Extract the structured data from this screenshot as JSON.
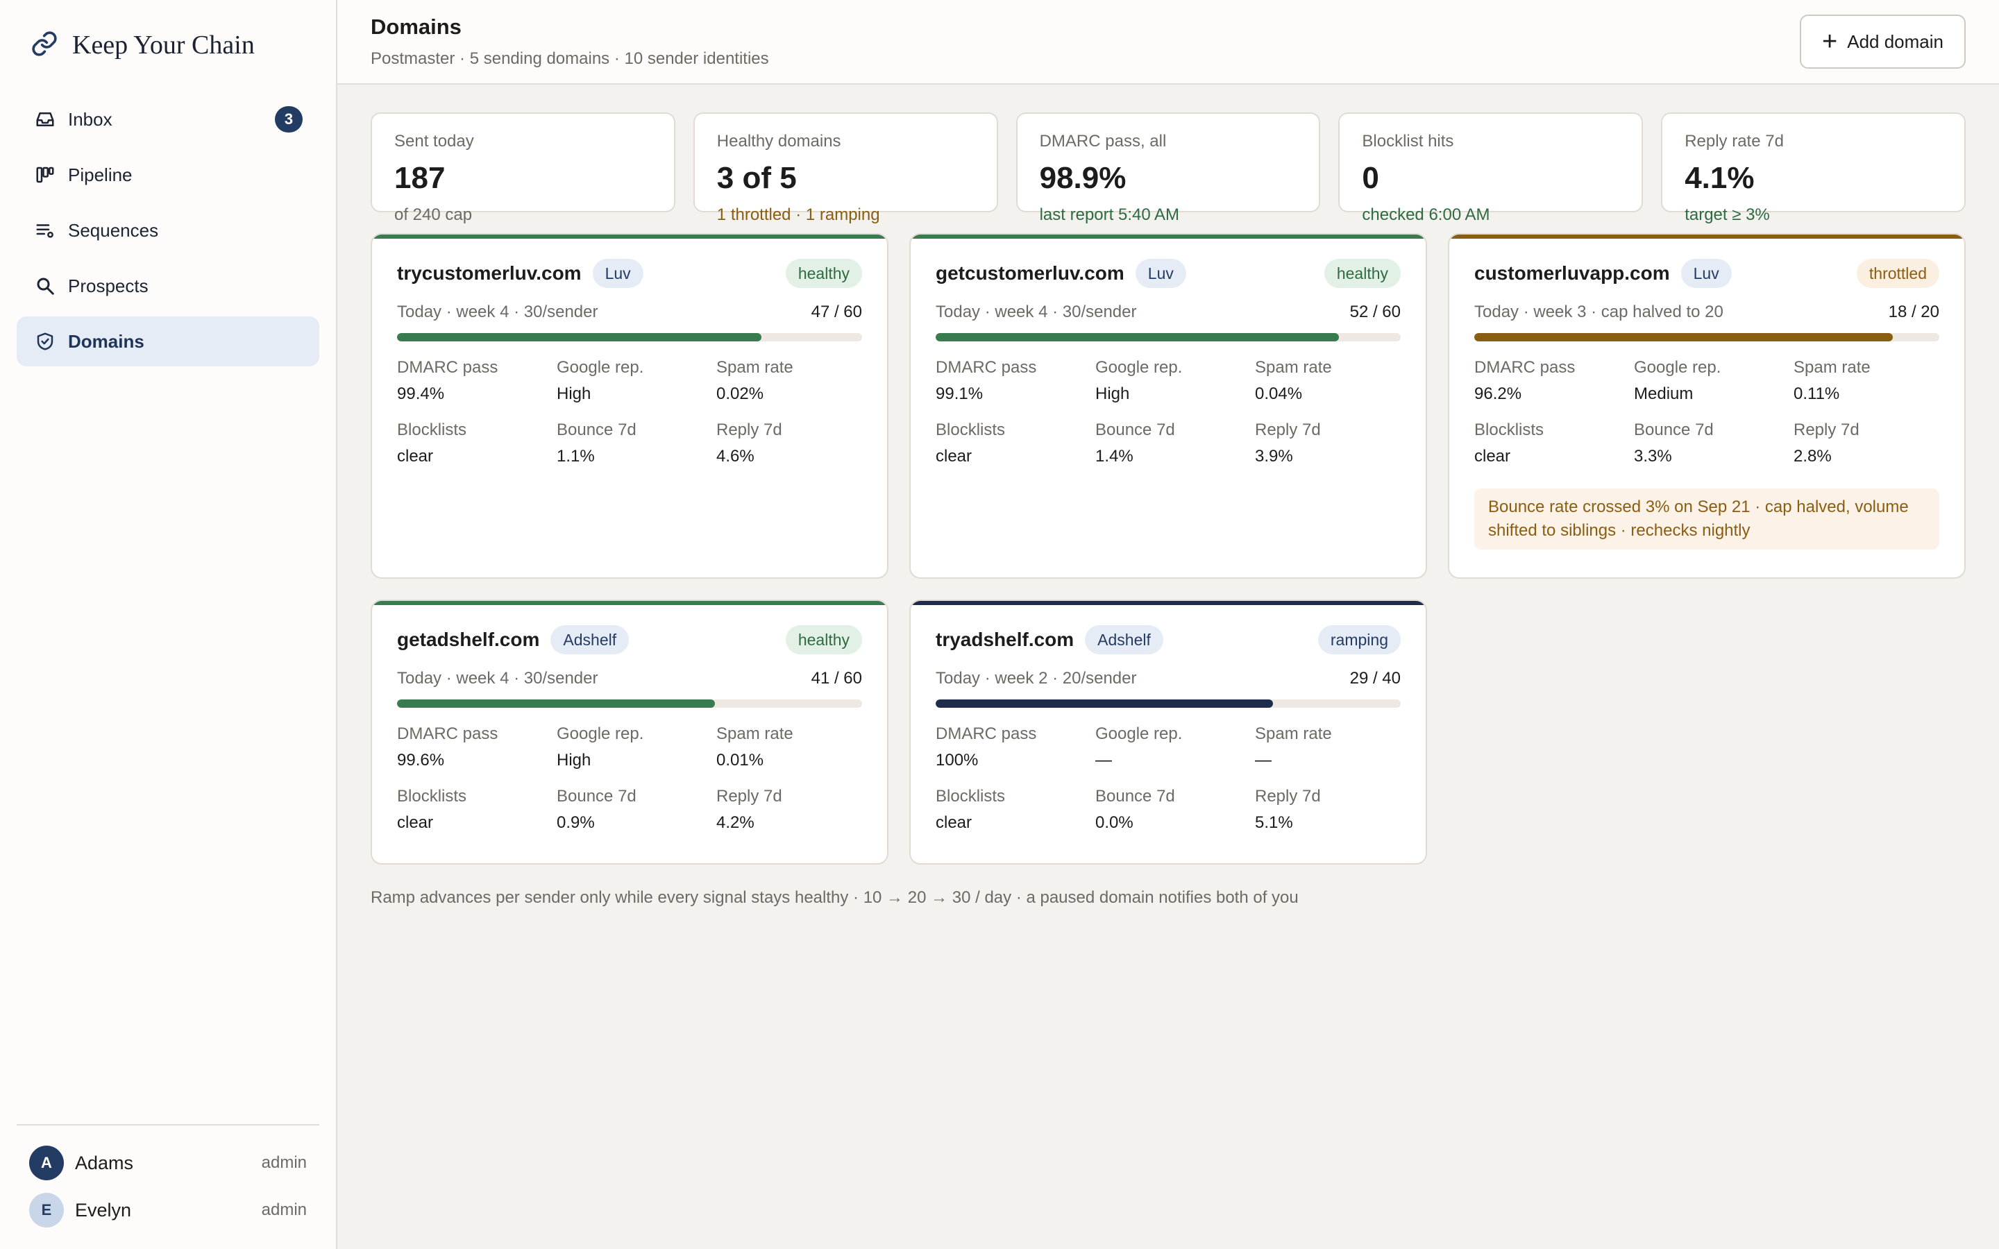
{
  "app": {
    "name": "Keep Your Chain",
    "logo_icon": "link-icon"
  },
  "sidebar": {
    "items": [
      {
        "label": "Inbox",
        "icon": "inbox-icon",
        "badge": "3"
      },
      {
        "label": "Pipeline",
        "icon": "kanban-icon"
      },
      {
        "label": "Sequences",
        "icon": "sequences-icon"
      },
      {
        "label": "Prospects",
        "icon": "search-icon"
      },
      {
        "label": "Domains",
        "icon": "shield-check-icon",
        "active": true
      }
    ],
    "users": [
      {
        "initial": "A",
        "name": "Adams",
        "role": "admin"
      },
      {
        "initial": "E",
        "name": "Evelyn",
        "role": "admin"
      }
    ]
  },
  "header": {
    "title": "Domains",
    "subtitle": "Postmaster · 5 sending domains · 10 sender identities",
    "add_label": "Add domain"
  },
  "stats": [
    {
      "label": "Sent today",
      "value": "187",
      "note": "of 240 cap"
    },
    {
      "label": "Healthy domains",
      "value": "3 of 5",
      "note": "1 throttled · 1 ramping"
    },
    {
      "label": "DMARC pass, all",
      "value": "98.9%",
      "note": "last report 5:40 AM"
    },
    {
      "label": "Blocklist hits",
      "value": "0",
      "note": "checked 6:00 AM"
    },
    {
      "label": "Reply rate 7d",
      "value": "4.1%",
      "note": "target ≥ 3%"
    }
  ],
  "domains": [
    {
      "domain": "trycustomerluv.com",
      "brand": "Luv",
      "status": "healthy",
      "quota_label": "Today · week 4 · 30/sender",
      "sent": 47,
      "cap": 60,
      "dmarc_label": "DMARC pass",
      "dmarc": "99.4%",
      "rep_label": "Google rep.",
      "rep": "High",
      "spam_label": "Spam rate",
      "spam": "0.02%",
      "block_label": "Blocklists",
      "blocklists": "clear",
      "bounce_label": "Bounce 7d",
      "bounce": "1.1%",
      "reply_label": "Reply 7d",
      "reply": "4.6%"
    },
    {
      "domain": "getcustomerluv.com",
      "brand": "Luv",
      "status": "healthy",
      "quota_label": "Today · week 4 · 30/sender",
      "sent": 52,
      "cap": 60,
      "dmarc_label": "DMARC pass",
      "dmarc": "99.1%",
      "rep_label": "Google rep.",
      "rep": "High",
      "spam_label": "Spam rate",
      "spam": "0.04%",
      "block_label": "Blocklists",
      "blocklists": "clear",
      "bounce_label": "Bounce 7d",
      "bounce": "1.4%",
      "reply_label": "Reply 7d",
      "reply": "3.9%"
    },
    {
      "domain": "customerluvapp.com",
      "brand": "Luv",
      "status": "throttled",
      "quota_label": "Today · week 3 · cap halved to 20",
      "sent": 18,
      "cap": 20,
      "dmarc_label": "DMARC pass",
      "dmarc": "96.2%",
      "rep_label": "Google rep.",
      "rep": "Medium",
      "spam_label": "Spam rate",
      "spam": "0.11%",
      "block_label": "Blocklists",
      "blocklists": "clear",
      "bounce_label": "Bounce 7d",
      "bounce": "3.3%",
      "reply_label": "Reply 7d",
      "reply": "2.8%",
      "alert": "Bounce rate crossed 3% on Sep 21 · cap halved, volume shifted to siblings · rechecks nightly"
    },
    {
      "domain": "getadshelf.com",
      "brand": "Adshelf",
      "status": "healthy",
      "quota_label": "Today · week 4 · 30/sender",
      "sent": 41,
      "cap": 60,
      "dmarc_label": "DMARC pass",
      "dmarc": "99.6%",
      "rep_label": "Google rep.",
      "rep": "High",
      "spam_label": "Spam rate",
      "spam": "0.01%",
      "block_label": "Blocklists",
      "blocklists": "clear",
      "bounce_label": "Bounce 7d",
      "bounce": "0.9%",
      "reply_label": "Reply 7d",
      "reply": "4.2%"
    },
    {
      "domain": "tryadshelf.com",
      "brand": "Adshelf",
      "status": "ramping",
      "quota_label": "Today · week 2 · 20/sender",
      "sent": 29,
      "cap": 40,
      "dmarc_label": "DMARC pass",
      "dmarc": "100%",
      "rep_label": "Google rep.",
      "rep": "—",
      "spam_label": "Spam rate",
      "spam": "—",
      "block_label": "Blocklists",
      "blocklists": "clear",
      "bounce_label": "Bounce 7d",
      "bounce": "0.0%",
      "reply_label": "Reply 7d",
      "reply": "5.1%"
    }
  ],
  "colors": {
    "healthy": "#3a7a4f",
    "throttled": "#8a5e12",
    "ramping": "#1f2d4d",
    "nav_active_bg": "#e5ecf6"
  },
  "footnote": "Ramp advances per sender only while every signal stays healthy · 10 → 20 → 30 / day · a paused domain notifies both of you"
}
